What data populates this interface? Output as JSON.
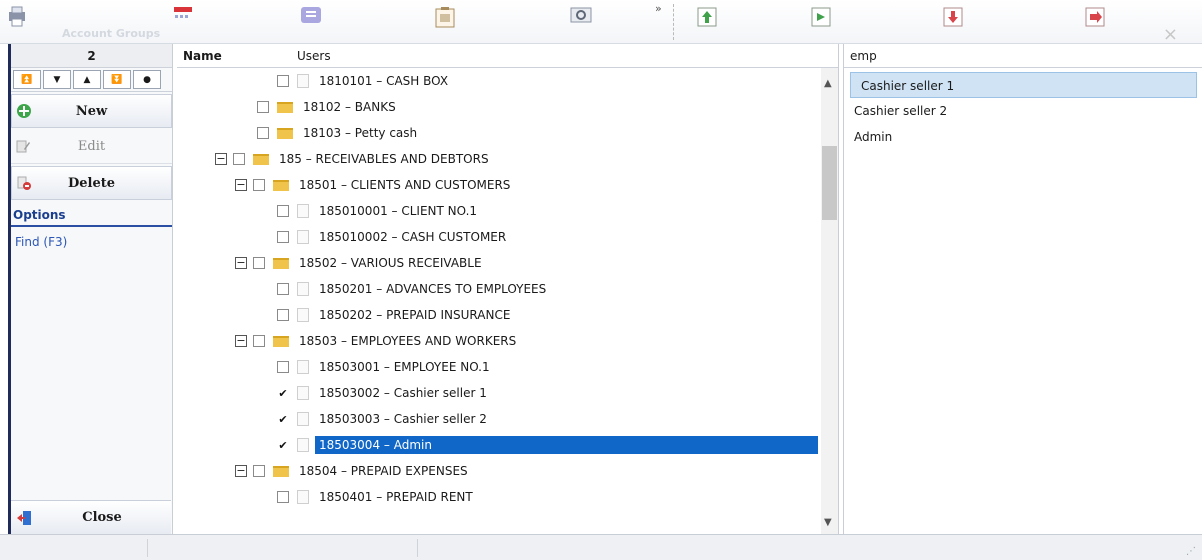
{
  "window": {
    "ghost_title": "Account Groups"
  },
  "toolbar": {
    "buttons": [
      {
        "name": "printer-icon"
      },
      {
        "name": "calendar-icon"
      },
      {
        "name": "report-icon"
      },
      {
        "name": "document-list-icon"
      },
      {
        "name": "preview-icon"
      },
      {
        "name": "up-arrow-doc-icon"
      },
      {
        "name": "forward-doc-icon"
      },
      {
        "name": "down-arrow-doc-icon"
      },
      {
        "name": "export-doc-icon"
      }
    ],
    "overflow_label": "»"
  },
  "left_panel": {
    "record_number": "2",
    "nav_buttons": [
      "⏫",
      "▼",
      "▲",
      "⏬",
      "●"
    ],
    "new_label": "New",
    "edit_label": "Edit",
    "delete_label": "Delete",
    "options_title": "Options",
    "find_label": "Find (F3)",
    "close_label": "Close"
  },
  "tree": {
    "col_name": "Name",
    "col_users": "Users",
    "rows": [
      {
        "label": "1810101 – CASH BOX",
        "type": "doc",
        "checked": false
      },
      {
        "label": "18102 – BANKS",
        "type": "folder",
        "checked": false
      },
      {
        "label": "18103 – Petty cash",
        "type": "folder",
        "checked": false
      },
      {
        "label": "185 – RECEIVABLES AND DEBTORS",
        "type": "folder",
        "checked": false
      },
      {
        "label": "18501 – CLIENTS AND CUSTOMERS",
        "type": "folder",
        "checked": false
      },
      {
        "label": "185010001 – CLIENT NO.1",
        "type": "doc",
        "checked": false
      },
      {
        "label": "185010002 – CASH CUSTOMER",
        "type": "doc",
        "checked": false
      },
      {
        "label": "18502 – VARIOUS RECEIVABLE",
        "type": "folder",
        "checked": false
      },
      {
        "label": "1850201 – ADVANCES TO EMPLOYEES",
        "type": "doc",
        "checked": false
      },
      {
        "label": "1850202 – PREPAID INSURANCE",
        "type": "doc",
        "checked": false
      },
      {
        "label": "18503 – EMPLOYEES AND WORKERS",
        "type": "folder",
        "checked": false
      },
      {
        "label": "18503001 – EMPLOYEE NO.1",
        "type": "doc",
        "checked": false
      },
      {
        "label": "18503002 – Cashier seller 1",
        "type": "doc",
        "checked": true
      },
      {
        "label": "18503003 – Cashier seller 2",
        "type": "doc",
        "checked": true
      },
      {
        "label": "18503004 – Admin",
        "type": "doc",
        "checked": true,
        "selected": true
      },
      {
        "label": "18504 – PREPAID EXPENSES",
        "type": "folder",
        "checked": false
      },
      {
        "label": "1850401 – PREPAID RENT",
        "type": "doc",
        "checked": false
      }
    ]
  },
  "right_panel": {
    "filter_value": "emp",
    "users": [
      "Cashier seller 1",
      "Cashier seller 2",
      "Admin"
    ]
  },
  "colors": {
    "selection": "#1167c7",
    "user_selection": "#cfe3f5",
    "options_accent": "#1b3f8f",
    "folder": "#f0c44a"
  }
}
